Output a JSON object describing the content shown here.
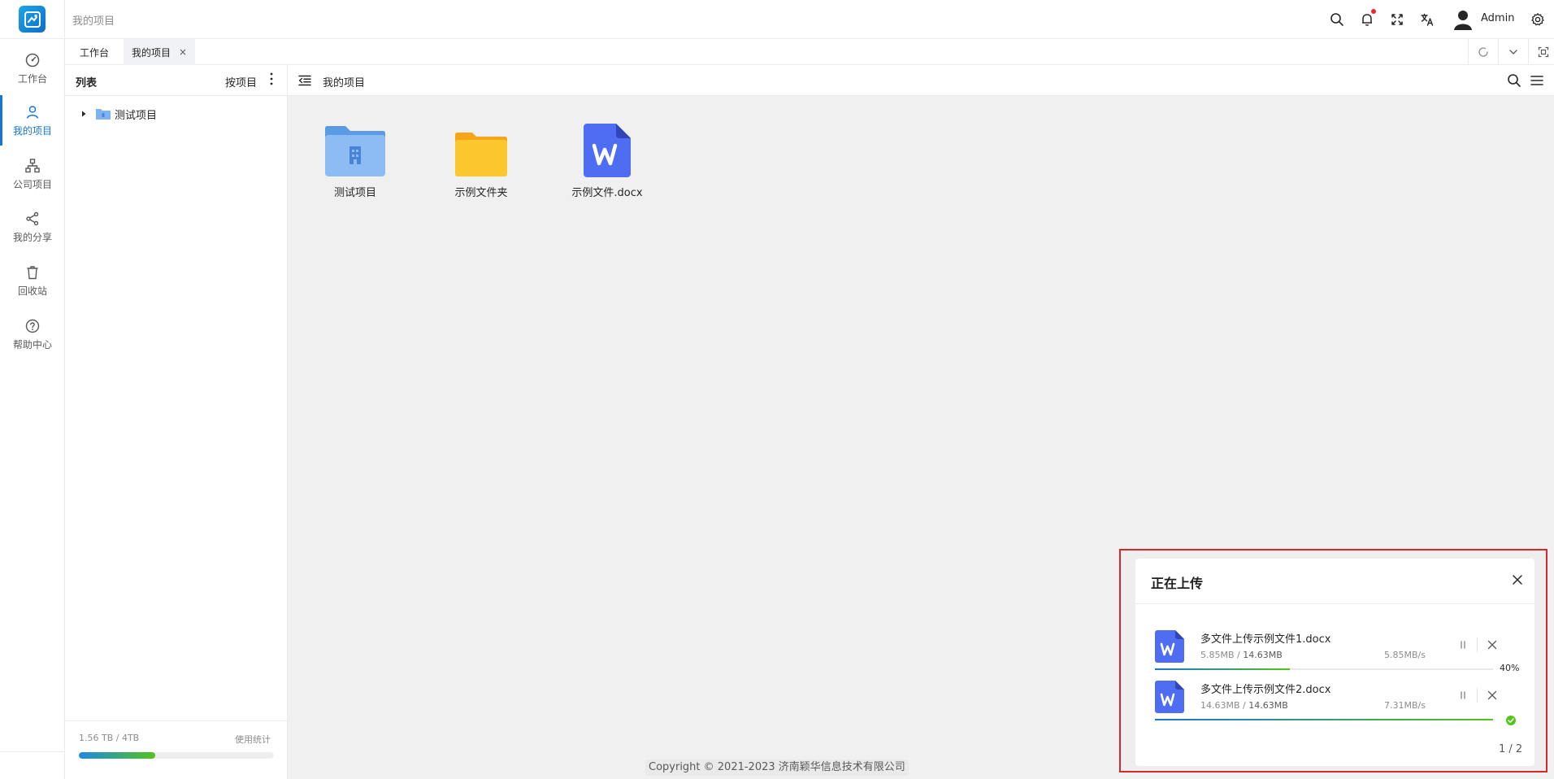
{
  "rail": {
    "items": [
      {
        "label": "工作台",
        "icon": "dashboard-icon"
      },
      {
        "label": "我的项目",
        "icon": "user-icon"
      },
      {
        "label": "公司项目",
        "icon": "org-chart-icon"
      },
      {
        "label": "我的分享",
        "icon": "share-icon"
      },
      {
        "label": "回收站",
        "icon": "trash-icon"
      },
      {
        "label": "帮助中心",
        "icon": "help-icon"
      }
    ],
    "active_index": 1
  },
  "header": {
    "breadcrumb": "我的项目",
    "user": "Admin",
    "icons": [
      "search-icon",
      "bell-icon",
      "fullscreen-icon",
      "translate-icon",
      "avatar",
      "gear-icon"
    ]
  },
  "tabs": {
    "items": [
      {
        "label": "工作台"
      },
      {
        "label": "我的项目",
        "closable": true
      }
    ],
    "close_glyph": "×"
  },
  "tree": {
    "title": "列表",
    "group_by": "按项目",
    "nodes": [
      {
        "label": "测试项目"
      }
    ],
    "storage": {
      "text": "1.56 TB / 4TB",
      "link": "使用统计",
      "used_fraction": 0.39
    }
  },
  "main": {
    "title": "我的项目",
    "files": [
      {
        "label": "测试项目",
        "icon": "project-folder-icon"
      },
      {
        "label": "示例文件夹",
        "icon": "folder-icon"
      },
      {
        "label": "示例文件.docx",
        "icon": "word-doc-icon"
      }
    ],
    "copyright": "Copyright © 2021-2023 济南颖华信息技术有限公司"
  },
  "upload": {
    "title": "正在上传",
    "items": [
      {
        "name": "多文件上传示例文件1.docx",
        "done": "5.85MB",
        "sep": " / ",
        "total": "14.63MB",
        "speed": "5.85MB/s",
        "progress": 0.4,
        "percent_text": "40%",
        "status": "uploading"
      },
      {
        "name": "多文件上传示例文件2.docx",
        "done": "14.63MB",
        "sep": " / ",
        "total": "14.63MB",
        "speed": "7.31MB/s",
        "progress": 1.0,
        "percent_text": "",
        "status": "done"
      }
    ],
    "count": "1 / 2"
  },
  "colors": {
    "accent": "#1677d2",
    "success": "#52c41a",
    "alert": "#f5222d",
    "highlight_border": "#d9262c"
  }
}
